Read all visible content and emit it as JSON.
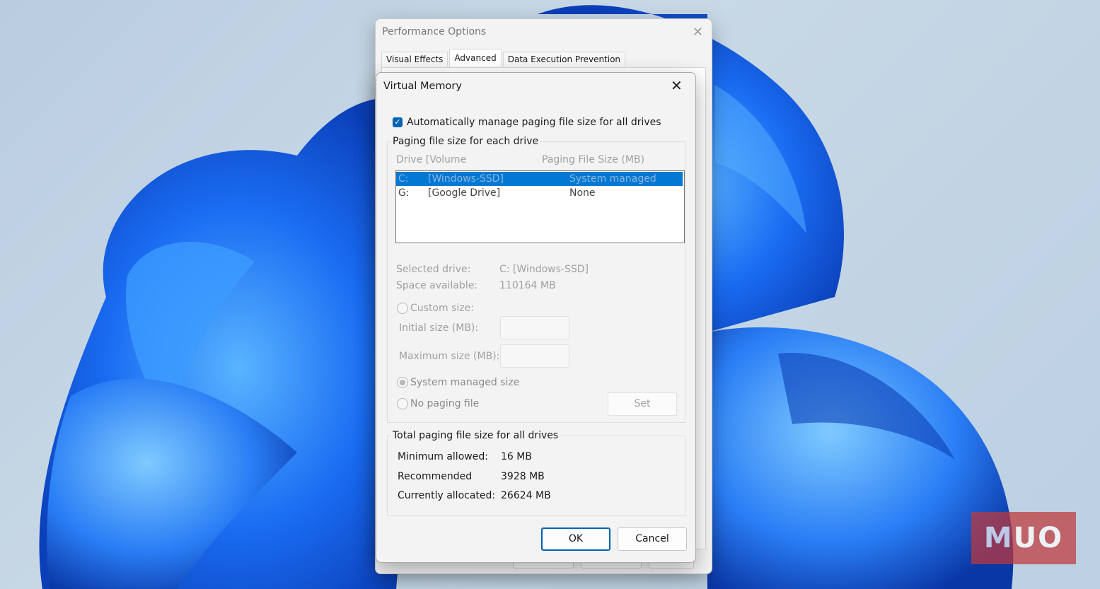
{
  "perf_options": {
    "title": "Performance Options",
    "tabs": [
      {
        "label": "Visual Effects"
      },
      {
        "label": "Advanced"
      },
      {
        "label": "Data Execution Prevention"
      }
    ]
  },
  "virtual_memory": {
    "title": "Virtual Memory",
    "auto_manage": {
      "label": "Automatically manage paging file size for all drives",
      "checked": true
    },
    "paging_group": {
      "legend": "Paging file size for each drive",
      "col_drive": "Drive  [Volume",
      "col_size": "Paging File Size (MB)",
      "drives": [
        {
          "letter": "C:",
          "volume": "[Windows-SSD]",
          "size": "System managed",
          "selected": true
        },
        {
          "letter": "G:",
          "volume": "[Google Drive]",
          "size": "None",
          "selected": false
        }
      ],
      "selected_drive_label": "Selected drive:",
      "selected_drive_value": "C:  [Windows-SSD]",
      "space_label": "Space available:",
      "space_value": "110164 MB",
      "custom_size_label": "Custom size:",
      "initial_size_label": "Initial size (MB):",
      "initial_size_value": "",
      "max_size_label": "Maximum size (MB):",
      "max_size_value": "",
      "system_managed_label": "System managed size",
      "no_paging_label": "No paging file",
      "set_label": "Set"
    },
    "total_group": {
      "legend": "Total paging file size for all drives",
      "min_label": "Minimum allowed:",
      "min_value": "16 MB",
      "rec_label": "Recommended",
      "rec_value": "3928 MB",
      "alloc_label": "Currently allocated:",
      "alloc_value": "26624 MB"
    },
    "ok_label": "OK",
    "cancel_label": "Cancel"
  },
  "watermark": "MUO",
  "colors": {
    "accent": "#0078d4",
    "checkbox": "#0063b1"
  }
}
